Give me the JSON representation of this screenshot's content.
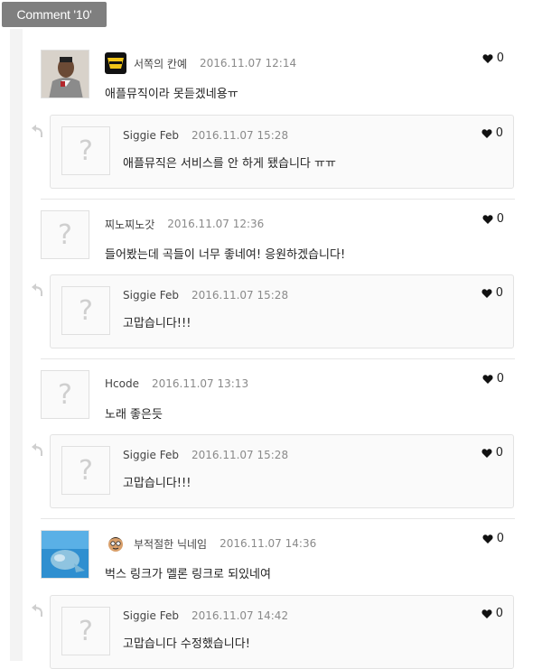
{
  "header": {
    "title": "Comment '10'"
  },
  "comments": [
    {
      "author": "서쪽의 칸예",
      "date": "2016.11.07 12:14",
      "text": "애플뮤직이라 못듣겠네용ㅠ",
      "likes": "0",
      "avatar": "photo",
      "badge_icon": "wu-tang-logo-icon",
      "reply": {
        "author": "Siggie Feb",
        "date": "2016.11.07 15:28",
        "text": "애플뮤직은 서비스를 안 하게 됐습니다 ㅠㅠ",
        "likes": "0"
      }
    },
    {
      "author": "찌노찌노갓",
      "date": "2016.11.07 12:36",
      "text": "들어봤는데 곡들이 너무 좋네여! 응원하겠습니다!",
      "likes": "0",
      "avatar": "placeholder",
      "reply": {
        "author": "Siggie Feb",
        "date": "2016.11.07 15:28",
        "text": "고맙습니다!!!",
        "likes": "0"
      }
    },
    {
      "author": "Hcode",
      "date": "2016.11.07 13:13",
      "text": "노래 좋은듯",
      "likes": "0",
      "avatar": "placeholder",
      "reply": {
        "author": "Siggie Feb",
        "date": "2016.11.07 15:28",
        "text": "고맙습니다!!!",
        "likes": "0"
      }
    },
    {
      "author": "부적절한 닉네임",
      "date": "2016.11.07 14:36",
      "text": "벅스 링크가 멜론 링크로 되있네여",
      "likes": "0",
      "avatar": "photo-blue",
      "badge_icon": "cartoon-face-icon",
      "reply": {
        "author": "Siggie Feb",
        "date": "2016.11.07 14:42",
        "text": "고맙습니다 수정했습니다!",
        "likes": "0"
      }
    }
  ],
  "placeholder_glyph": "?",
  "colors": {
    "badge_bg": "#7f7f7f",
    "reply_bg": "#fafafa",
    "border": "#e3e3e3",
    "date": "#8a8a8a"
  }
}
